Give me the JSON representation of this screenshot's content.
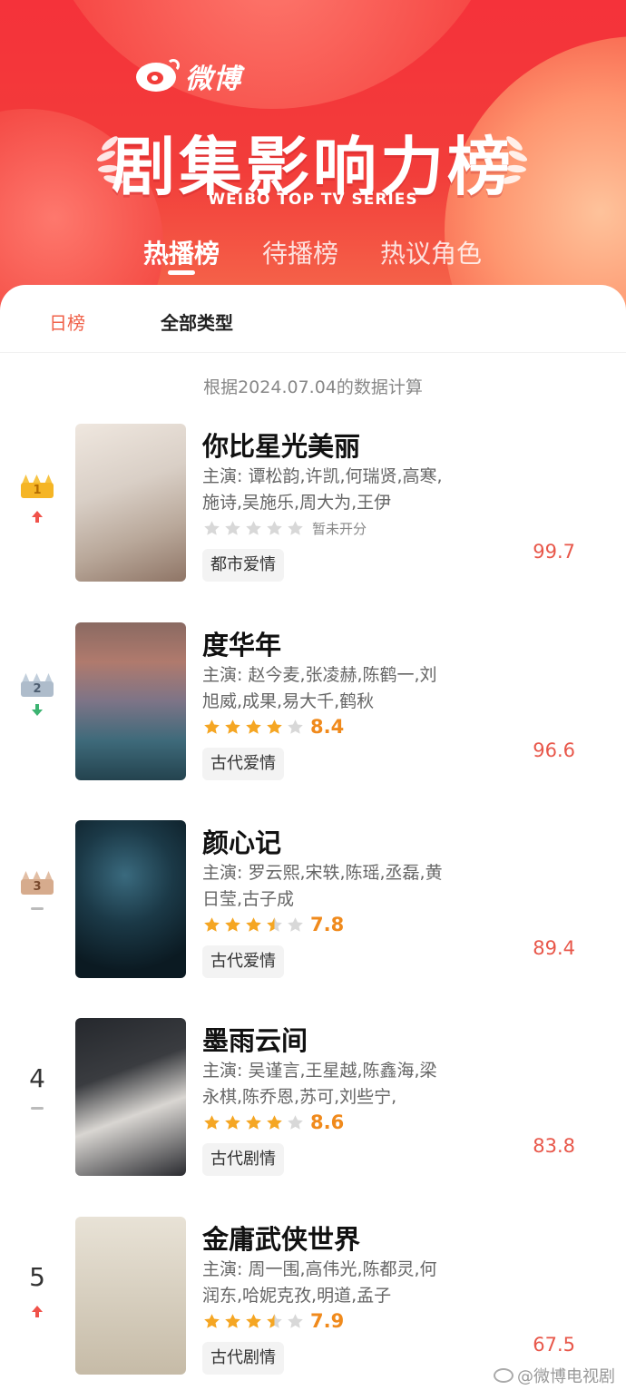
{
  "brand": {
    "name": "微博"
  },
  "header": {
    "title": "剧集影响力榜",
    "subtitle": "WEIBO TOP TV SERIES",
    "tabs": [
      {
        "label": "热播榜",
        "active": true
      },
      {
        "label": "待播榜",
        "active": false
      },
      {
        "label": "热议角色",
        "active": false
      }
    ]
  },
  "filters": {
    "period": "日榜",
    "category": "全部类型"
  },
  "data_note": "根据2024.07.04的数据计算",
  "colors": {
    "accent": "#f23d3a",
    "heat": "#e8574a",
    "score": "#f08a1c"
  },
  "rankings": [
    {
      "rank": "1",
      "badge": "gold-crown",
      "trend": "up",
      "title": "你比星光美丽",
      "cast": "主演: 谭松韵,许凯,何瑞贤,高寒,施诗,吴施乐,周大为,王伊",
      "stars": 0,
      "score": "",
      "unrated_text": "暂未开分",
      "genre": "都市爱情",
      "heat": "99.7",
      "poster_caption": "你比星光美丽"
    },
    {
      "rank": "2",
      "badge": "silver-crown",
      "trend": "down",
      "title": "度华年",
      "cast": "主演: 赵今麦,张凌赫,陈鹤一,刘旭威,成果,易大千,鹤秋",
      "stars": 4,
      "score": "8.4",
      "unrated_text": "",
      "genre": "古代爱情",
      "heat": "96.6",
      "poster_caption": "度华年"
    },
    {
      "rank": "3",
      "badge": "bronze-crown",
      "trend": "flat",
      "title": "颜心记",
      "cast": "主演: 罗云熙,宋轶,陈瑶,丞磊,黄日莹,古子成",
      "stars": 3.5,
      "score": "7.8",
      "unrated_text": "",
      "genre": "古代爱情",
      "heat": "89.4",
      "poster_caption": "颜心记"
    },
    {
      "rank": "4",
      "badge": "",
      "trend": "flat",
      "title": "墨雨云间",
      "cast": "主演: 吴谨言,王星越,陈鑫海,梁永棋,陈乔恩,苏可,刘些宁,",
      "stars": 4,
      "score": "8.6",
      "unrated_text": "",
      "genre": "古代剧情",
      "heat": "83.8",
      "poster_caption": "墨雨云间"
    },
    {
      "rank": "5",
      "badge": "",
      "trend": "up",
      "title": "金庸武侠世界",
      "cast": "主演: 周一围,高伟光,陈都灵,何润东,哈妮克孜,明道,孟子",
      "stars": 3.5,
      "score": "7.9",
      "unrated_text": "",
      "genre": "古代剧情",
      "heat": "67.5",
      "poster_caption": "金庸武侠世界"
    }
  ],
  "watermark": "@微博电视剧"
}
